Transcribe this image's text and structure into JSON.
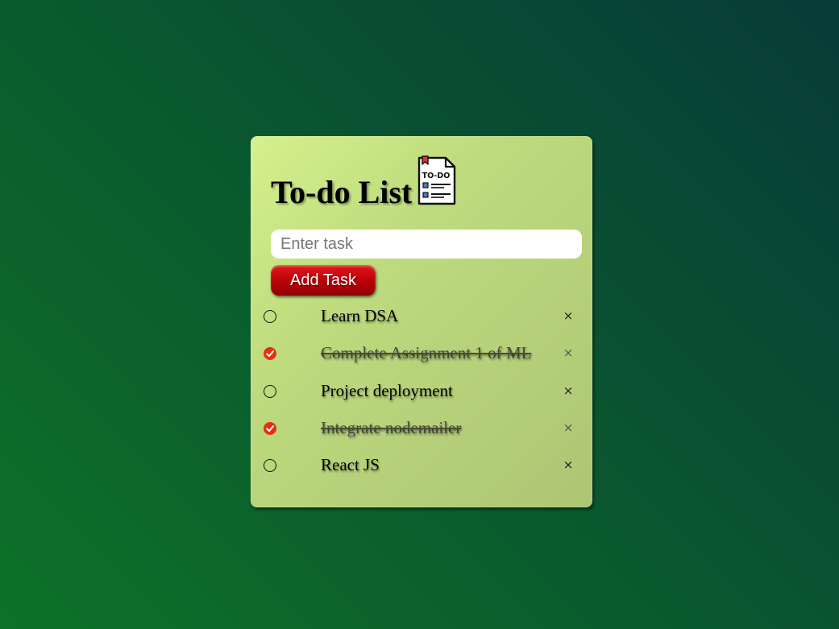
{
  "app": {
    "title": "To-do List",
    "icon": "todo-clipboard-icon",
    "icon_text": "TO-DO"
  },
  "input": {
    "placeholder": "Enter task",
    "value": ""
  },
  "add_button": {
    "label": "Add Task"
  },
  "tasks": [
    {
      "text": "Learn DSA",
      "done": false
    },
    {
      "text": "Complete Assignment 1 of ML",
      "done": true
    },
    {
      "text": "Project deployment",
      "done": false
    },
    {
      "text": "Integrate nodemailer",
      "done": true
    },
    {
      "text": "React JS",
      "done": false
    }
  ],
  "delete_symbol": "×",
  "colors": {
    "background_start": "#0e7228",
    "background_end": "#073b39",
    "card": "#c2dd80",
    "button": "#c8000a",
    "check_done": "#e8300f"
  }
}
